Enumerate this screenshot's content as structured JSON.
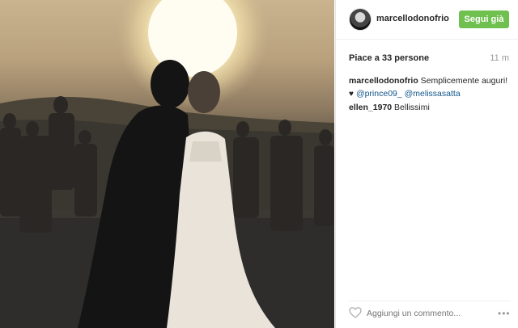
{
  "post": {
    "username": "marcellodonofrio",
    "follow_label": "Segui già",
    "likes": "Piace a 33 persone",
    "time": "11 m"
  },
  "caption": {
    "user": "marcellodonofrio",
    "text": " Semplicemente auguri!",
    "mention1": "@prince09_",
    "mention2": "@melissasatta"
  },
  "comments": [
    {
      "user": "ellen_1970",
      "text": " Bellissimi"
    }
  ],
  "comment_box": {
    "placeholder": "Aggiungi un commento..."
  },
  "icons": {
    "heart": "heart-icon",
    "more": "more-options-icon",
    "avatar": "avatar"
  },
  "colors": {
    "follow": "#70c050",
    "mention": "#125688"
  }
}
